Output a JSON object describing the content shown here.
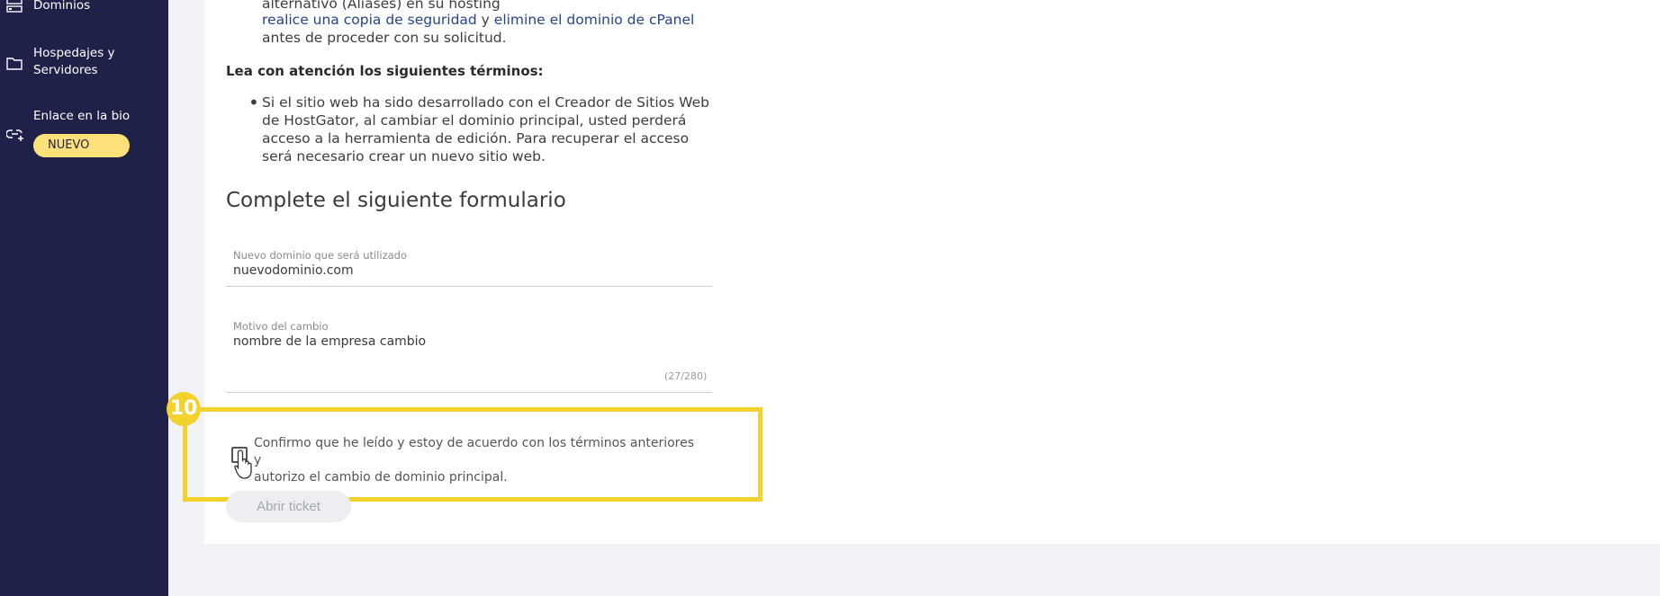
{
  "sidebar": {
    "items": [
      {
        "label": "Dominios",
        "icon": "server-icon"
      },
      {
        "label": "Hospedajes y",
        "label2": "Servidores",
        "icon": "folder-icon"
      },
      {
        "label": "Enlace en la bio",
        "icon": "link-add-icon",
        "badge": "NUEVO"
      }
    ]
  },
  "content": {
    "line0": "alternativo (Aliases) en su hosting",
    "link_backup": "realice una copia de seguridad",
    "conj_y": " y ",
    "link_remove": "elimine el dominio de cPanel",
    "line_before": "antes de proceder con su solicitud.",
    "terms_heading": "Lea con atención los siguientes términos:",
    "bullet_lines": [
      "Si el sitio web ha sido desarrollado con el Creador de Sitios Web",
      "de HostGator, al cambiar el dominio principal, usted perderá",
      "acceso a la herramienta de edición. Para recuperar el acceso",
      "será necesario crear un nuevo sitio web."
    ],
    "form_title": "Complete el siguiente formulario"
  },
  "form": {
    "domain_label": "Nuevo dominio que será utilizado",
    "domain_value": "nuevodominio.com",
    "reason_label": "Motivo del cambio",
    "reason_value": "nombre de la empresa cambio",
    "counter": "(27/280)",
    "confirm_line1": "Confirmo que he leído y estoy de acuerdo con los términos anteriores y",
    "confirm_line2": "autorizo el cambio de dominio principal.",
    "submit_label": "Abrir ticket"
  },
  "annotation": {
    "step": "10",
    "color": "#f2d22b"
  },
  "colors": {
    "sidebar": "#1f2149",
    "link": "#24448f",
    "badge": "#ffe17a"
  }
}
